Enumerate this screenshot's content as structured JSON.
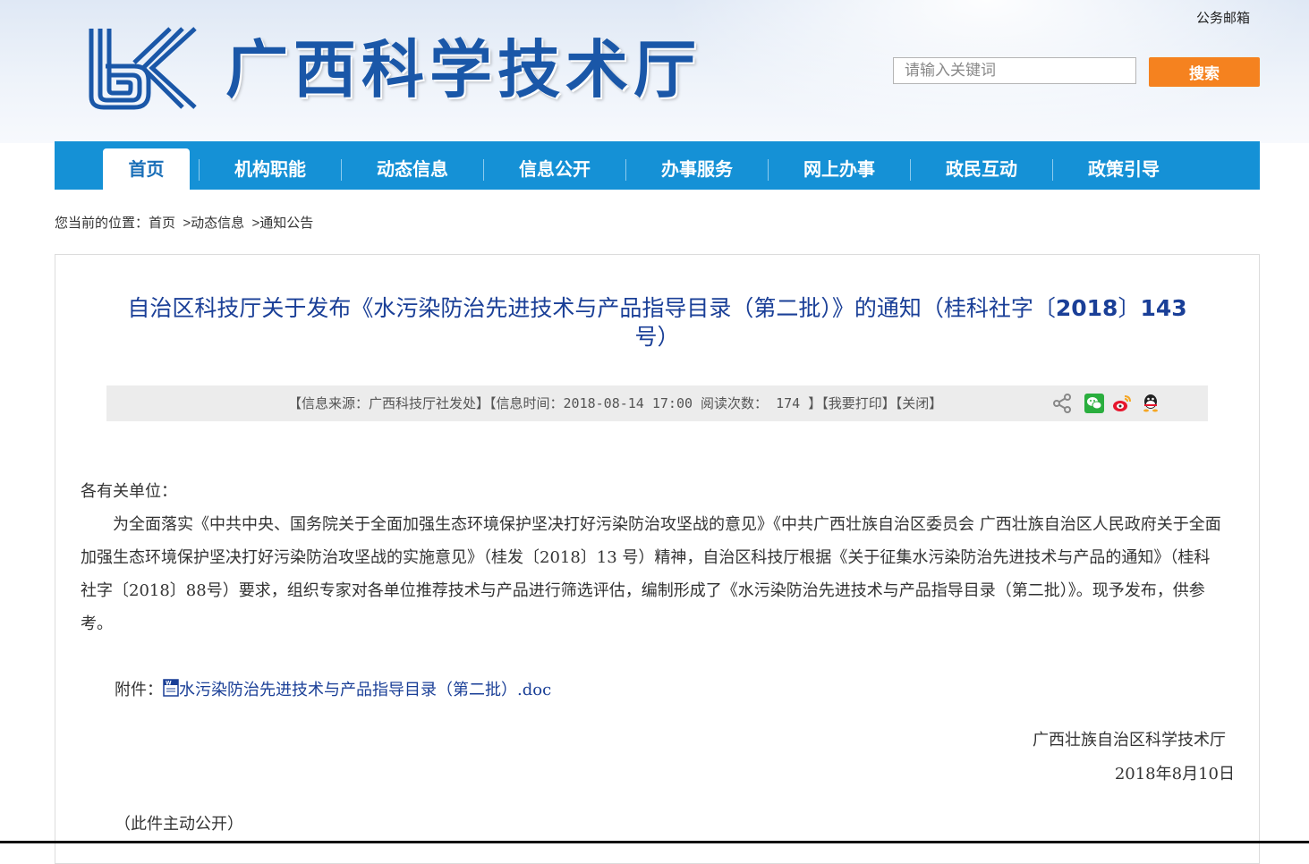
{
  "header": {
    "site_title": "广西科学技术厅",
    "mailbox": "公务邮箱",
    "search": {
      "placeholder": "请输入关键词",
      "button": "搜索"
    }
  },
  "nav": {
    "items": [
      {
        "label": "首页",
        "active": true
      },
      {
        "label": "机构职能"
      },
      {
        "label": "动态信息"
      },
      {
        "label": "信息公开"
      },
      {
        "label": "办事服务"
      },
      {
        "label": "网上办事"
      },
      {
        "label": "政民互动"
      },
      {
        "label": "政策引导"
      }
    ]
  },
  "breadcrumb": {
    "prefix": "您当前的位置：",
    "items": [
      "首页",
      ">动态信息",
      ">通知公告"
    ]
  },
  "article": {
    "title_text": "自治区科技厅关于发布《水污染防治先进技术与产品指导目录（第二批）》的通知（桂科社字〔",
    "title_year": "2018",
    "title_mid": "〕",
    "title_num": "143",
    "title_end": "号）",
    "meta": {
      "source": "【信息来源：广西科技厅社发处】",
      "time": "【信息时间：2018-08-14 17:00 阅读次数：  174  】",
      "print": "【我要打印】",
      "close": "【关闭】"
    },
    "share_icons": [
      "share-icon",
      "wechat-icon",
      "weibo-icon",
      "qq-icon"
    ],
    "salutation": "各有关单位：",
    "paragraph": "为全面落实《中共中央、国务院关于全面加强生态环境保护坚决打好污染防治攻坚战的意见》《中共广西壮族自治区委员会 广西壮族自治区人民政府关于全面加强生态环境保护坚决打好污染防治攻坚战的实施意见》（桂发〔2018〕13 号）精神，自治区科技厅根据《关于征集水污染防治先进技术与产品的通知》（桂科社字〔2018〕88号）要求，组织专家对各单位推荐技术与产品进行筛选评估，编制形成了《水污染防治先进技术与产品指导目录（第二批）》。现予发布，供参考。",
    "attachment_label": "附件：",
    "attachment_file": "水污染防治先进技术与产品指导目录（第二批）.doc",
    "signature": "广西壮族自治区科学技术厅",
    "date": "2018年8月10日",
    "public_note": "（此件主动公开）"
  },
  "colors": {
    "nav_blue": "#1591d6",
    "title_blue": "#1a3f97",
    "search_orange": "#f5821f"
  }
}
